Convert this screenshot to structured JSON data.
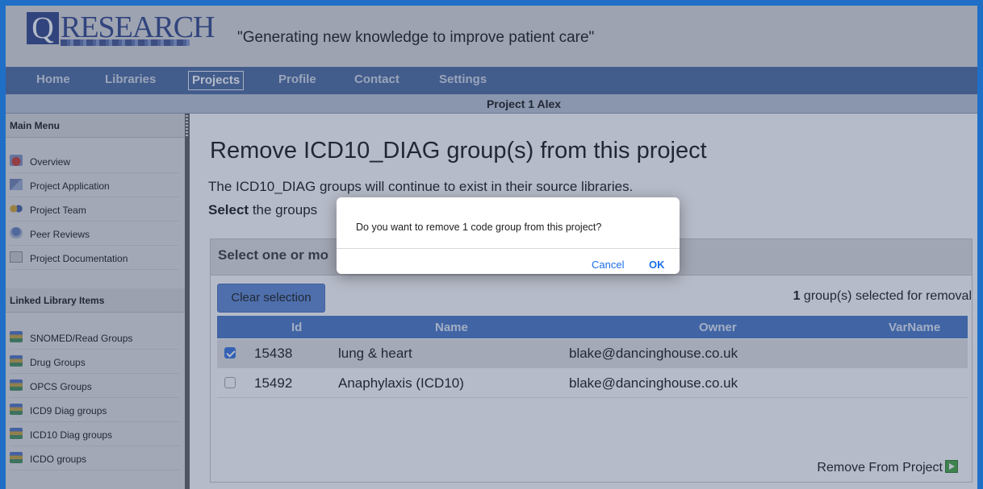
{
  "header": {
    "logo_letter": "Q",
    "logo_text": "RESEARCH",
    "tagline": "\"Generating new knowledge to improve patient care\""
  },
  "nav": {
    "items": [
      "Home",
      "Libraries",
      "Projects",
      "Profile",
      "Contact",
      "Settings"
    ],
    "active": "Projects"
  },
  "project_bar": {
    "title": "Project 1 Alex"
  },
  "sidebar": {
    "main_menu_title": "Main Menu",
    "main_menu": [
      {
        "label": "Overview",
        "icon": "overview-icon"
      },
      {
        "label": "Project Application",
        "icon": "application-icon"
      },
      {
        "label": "Project Team",
        "icon": "team-icon"
      },
      {
        "label": "Peer Reviews",
        "icon": "peer-review-icon"
      },
      {
        "label": "Project Documentation",
        "icon": "document-icon"
      }
    ],
    "linked_title": "Linked Library Items",
    "linked_items": [
      {
        "label": "SNOMED/Read Groups",
        "icon": "library-books-icon"
      },
      {
        "label": "Drug Groups",
        "icon": "library-books-icon"
      },
      {
        "label": "OPCS Groups",
        "icon": "library-books-icon"
      },
      {
        "label": "ICD9 Diag groups",
        "icon": "library-books-icon"
      },
      {
        "label": "ICD10 Diag groups",
        "icon": "library-books-icon"
      },
      {
        "label": "ICDO groups",
        "icon": "library-books-icon"
      }
    ]
  },
  "main": {
    "title": "Remove ICD10_DIAG group(s) from this project",
    "line1": "The ICD10_DIAG groups will continue to exist in their source libraries.",
    "line2_bold": "Select",
    "line2_rest": " the groups",
    "panel_title": "Select one or mo",
    "clear_button": "Clear selection",
    "selected_count": "1",
    "selected_suffix": " group(s) selected for removal",
    "columns": [
      "Id",
      "Name",
      "Owner",
      "VarName"
    ],
    "rows": [
      {
        "checked": true,
        "id": "15438",
        "name": "lung & heart",
        "owner": "blake@dancinghouse.co.uk",
        "varname": ""
      },
      {
        "checked": false,
        "id": "15492",
        "name": "Anaphylaxis (ICD10)",
        "owner": "blake@dancinghouse.co.uk",
        "varname": ""
      }
    ],
    "remove_link": "Remove From Project"
  },
  "dialog": {
    "message": "Do you want to remove 1 code group from this project?",
    "cancel": "Cancel",
    "ok": "OK"
  },
  "colors": {
    "nav_bg": "#46679e",
    "grid_header": "#4373c6",
    "link_blue": "#1a6ee8",
    "frame_border": "#1f6fc7"
  }
}
